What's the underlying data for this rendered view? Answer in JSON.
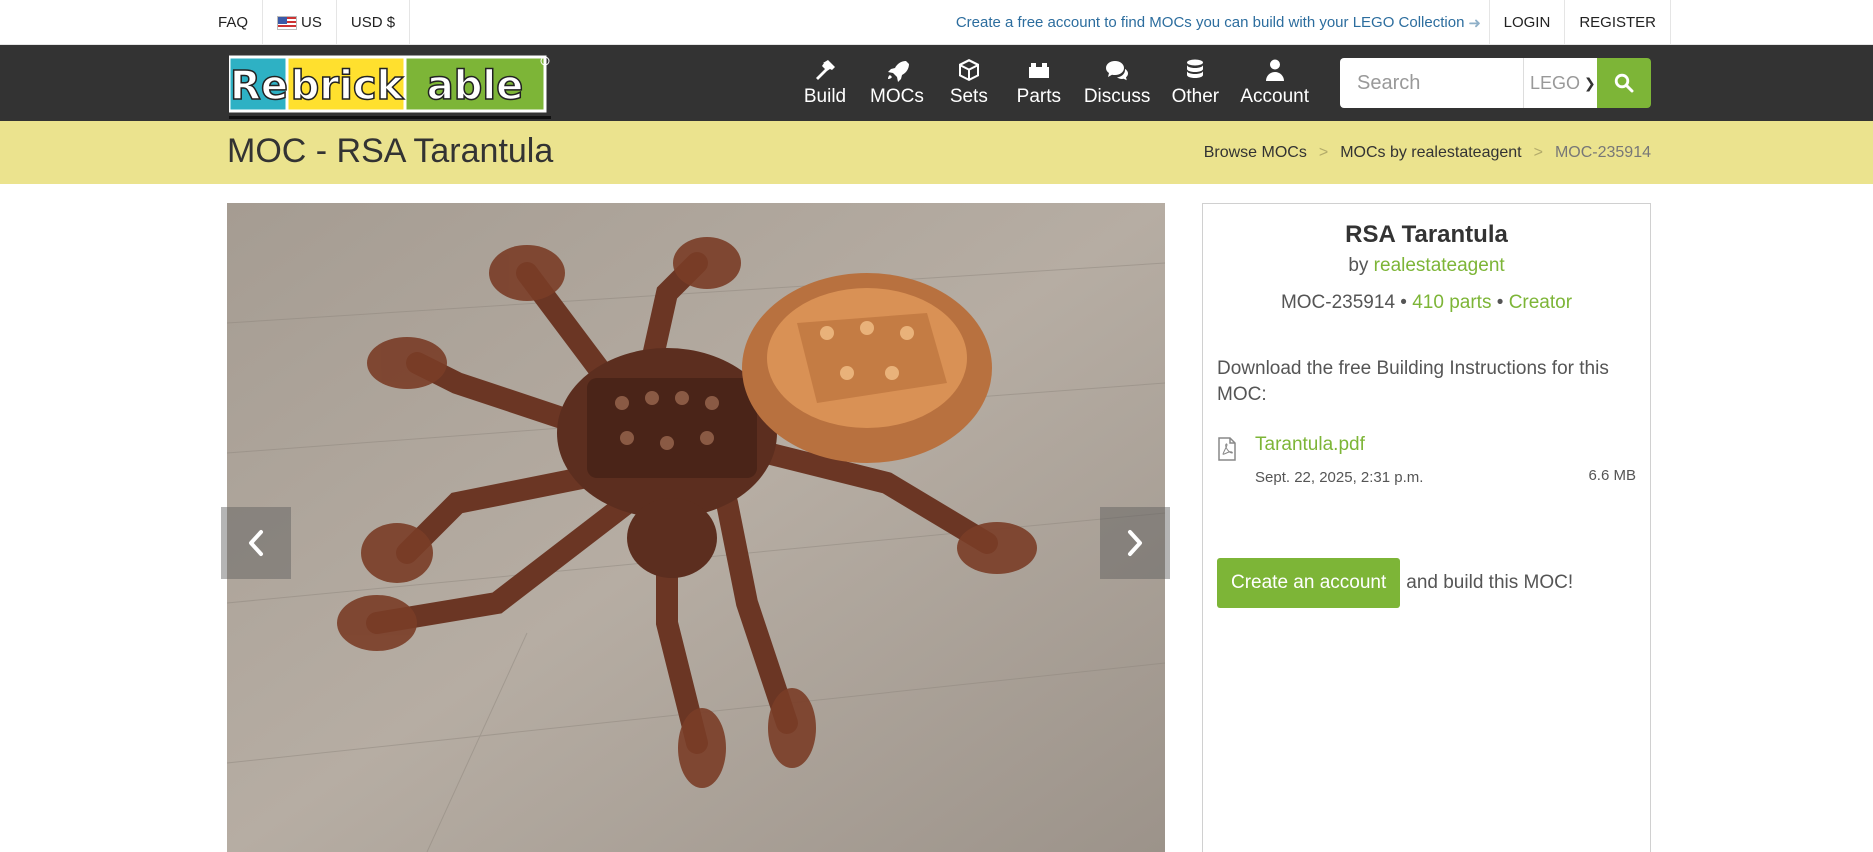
{
  "topbar": {
    "faq": "FAQ",
    "country": "US",
    "currency": "USD $",
    "promo": "Create a free account to find MOCs you can build with your LEGO Collection",
    "login": "LOGIN",
    "register": "REGISTER"
  },
  "brand": {
    "logo_parts": [
      "Re",
      "brick",
      "able"
    ],
    "colors": {
      "teal": "#2eb1c4",
      "yellow": "#ffe02e",
      "green": "#7db537",
      "nav_bg": "#333333",
      "title_band": "#ebe38e"
    }
  },
  "nav": {
    "items": [
      {
        "label": "Build",
        "icon": "hammer-icon"
      },
      {
        "label": "MOCs",
        "icon": "rocket-icon"
      },
      {
        "label": "Sets",
        "icon": "cube-icon"
      },
      {
        "label": "Parts",
        "icon": "brick-icon"
      },
      {
        "label": "Discuss",
        "icon": "chat-icon"
      },
      {
        "label": "Other",
        "icon": "database-icon"
      },
      {
        "label": "Account",
        "icon": "user-icon"
      }
    ],
    "search_placeholder": "Search",
    "search_scope": "LEGO"
  },
  "page": {
    "title": "MOC - RSA Tarantula",
    "breadcrumb": [
      "Browse MOCs",
      "MOCs by realestateagent",
      "MOC-235914"
    ]
  },
  "moc": {
    "name": "RSA Tarantula",
    "by_prefix": "by",
    "author": "realestateagent",
    "id": "MOC-235914",
    "bullet": "•",
    "parts": "410 parts",
    "role": "Creator",
    "download_text": "Download the free Building Instructions for this MOC:",
    "file_name": "Tarantula.pdf",
    "file_date": "Sept. 22, 2025, 2:31 p.m.",
    "file_size": "6.6 MB",
    "cta_button": "Create an account",
    "cta_text": "and build this MOC!"
  }
}
